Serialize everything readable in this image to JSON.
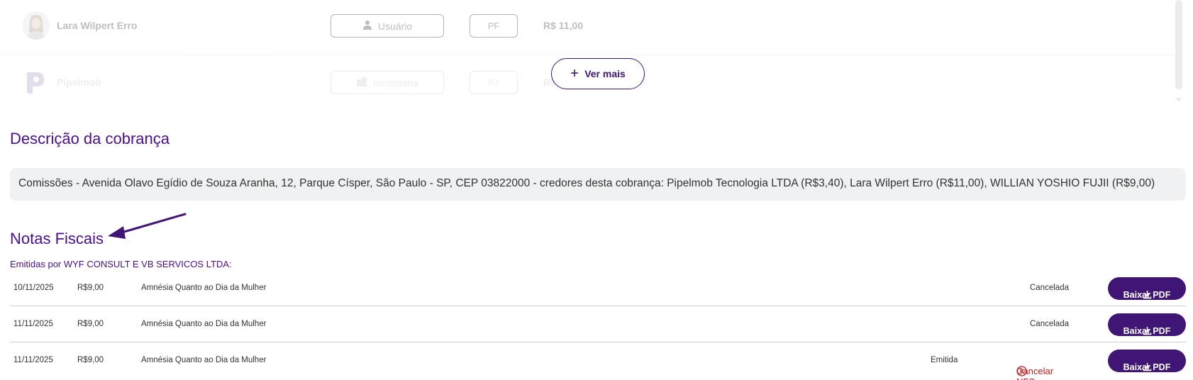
{
  "recipients": [
    {
      "name": "Lara Wilpert Erro",
      "role": "Usuário",
      "type": "PF",
      "amount": "R$ 11,00",
      "avatar_icon": "person-photo-icon",
      "role_icon": "user-icon"
    },
    {
      "name": "Pipelmob",
      "role": "Imobiliária",
      "type": "PJ",
      "amount": "R$",
      "avatar_icon": "pipelmob-logo-icon",
      "role_icon": "building-icon"
    }
  ],
  "ver_mais_label": "Ver mais",
  "description": {
    "title": "Descrição da cobrança",
    "text": "Comissões - Avenida Olavo Egídio de Souza Aranha, 12, Parque Císper, São Paulo - SP, CEP 03822000 - credores desta cobrança: Pipelmob Tecnologia LTDA (R$3,40), Lara Wilpert Erro (R$11,00), WILLIAN YOSHIO FUJII (R$9,00)"
  },
  "invoices": {
    "title": "Notas Fiscais",
    "emitter": "Emitidas por WYF CONSULT E VB SERVICOS LTDA:",
    "rows": [
      {
        "date": "10/11/2025",
        "value": "R$9,00",
        "description": "Amnésia Quanto ao Dia da Mulher",
        "status": "Cancelada",
        "action": "Baixar PDF"
      },
      {
        "date": "11/11/2025",
        "value": "R$9,00",
        "description": "Amnésia Quanto ao Dia da Mulher",
        "status": "Cancelada",
        "action": "Baixar PDF"
      },
      {
        "date": "11/11/2025",
        "value": "R$9,00",
        "description": "Amnésia Quanto ao Dia da Mulher",
        "status": "Emitida",
        "cancel_label": "Cancelar NFSe",
        "action": "Baixar PDF"
      }
    ]
  },
  "colors": {
    "brand_purple": "#3f1575",
    "title_purple": "#4a0f8a",
    "danger_red": "#c01c1c",
    "desc_bg": "#f0f1f2"
  }
}
